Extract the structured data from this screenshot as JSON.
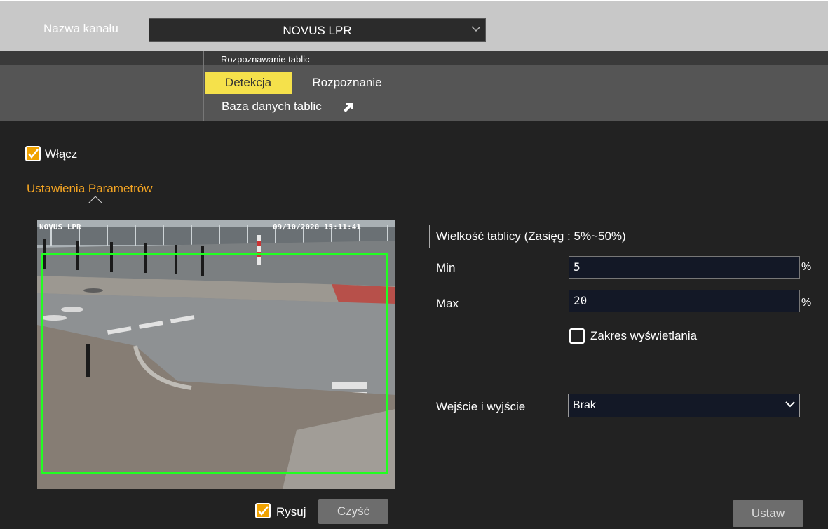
{
  "channel": {
    "label": "Nazwa kanału",
    "selected": "NOVUS LPR"
  },
  "menu": {
    "title": "Rozpoznawanie tablic",
    "tabs": [
      {
        "label": "Detekcja",
        "active": true
      },
      {
        "label": "Rozpoznanie",
        "active": false
      }
    ],
    "database_link": "Baza danych tablic"
  },
  "enable": {
    "label": "Włącz",
    "checked": true
  },
  "section": {
    "title": "Ustawienia Parametrów"
  },
  "video": {
    "osd_name": "NOVUS LPR",
    "osd_time": "09/10/2020 15:11:41"
  },
  "draw": {
    "label": "Rysuj",
    "checked": true
  },
  "clear_button": "Czyść",
  "plate_size": {
    "title": "Wielkość tablicy (Zasięg : 5%~50%)",
    "min_label": "Min",
    "min_value": "5",
    "max_label": "Max",
    "max_value": "20",
    "unit": "%"
  },
  "display_range": {
    "label": "Zakres wyświetlania",
    "checked": false
  },
  "io": {
    "label": "Wejście i wyjście",
    "selected": "Brak"
  },
  "set_button": "Ustaw",
  "colors": {
    "accent_yellow": "#f5e14b",
    "section_orange": "#f6a623",
    "roi_green": "#21ff21"
  }
}
